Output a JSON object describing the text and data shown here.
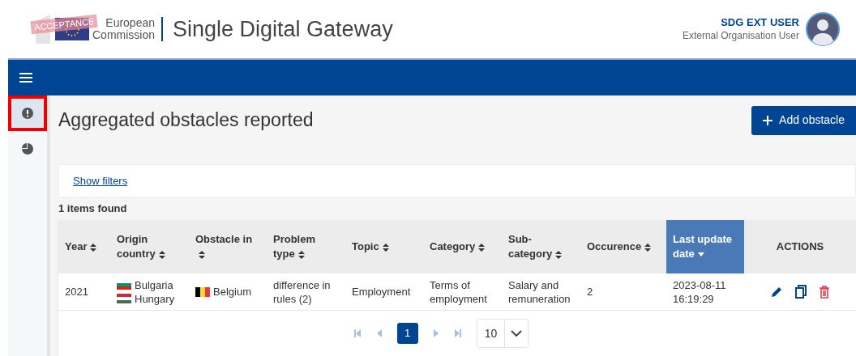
{
  "header": {
    "logo": {
      "line1": "European",
      "line2": "Commission",
      "stamp": "ACCEPTANCE"
    },
    "app_title": "Single Digital Gateway",
    "user": {
      "name": "SDG EXT USER",
      "role": "External Organisation User"
    }
  },
  "sidebar": {
    "items": [
      {
        "kind": "alert",
        "selected": true
      },
      {
        "kind": "chart",
        "selected": false
      }
    ]
  },
  "page": {
    "title": "Aggregated obstacles reported",
    "add_button": "Add obstacle",
    "filters_link": "Show filters",
    "count": "1 items found"
  },
  "table": {
    "columns": [
      {
        "label": "Year",
        "sortable": true,
        "sorted": false,
        "selected": false
      },
      {
        "label": "Origin country",
        "sortable": true,
        "sorted": false,
        "selected": false
      },
      {
        "label": "Obstacle in",
        "sortable": true,
        "sorted": false,
        "selected": false
      },
      {
        "label": "Problem type",
        "sortable": true,
        "sorted": false,
        "selected": false
      },
      {
        "label": "Topic",
        "sortable": true,
        "sorted": false,
        "selected": false
      },
      {
        "label": "Category",
        "sortable": true,
        "sorted": false,
        "selected": false
      },
      {
        "label": "Sub-category",
        "sortable": true,
        "sorted": false,
        "selected": false
      },
      {
        "label": "Occurence",
        "sortable": true,
        "sorted": false,
        "selected": false
      },
      {
        "label": "Last update date",
        "sortable": true,
        "sorted": true,
        "selected": true
      },
      {
        "label": "ACTIONS",
        "sortable": false,
        "selected": false
      }
    ],
    "rows": [
      {
        "year": "2021",
        "origin": [
          {
            "name": "Bulgaria",
            "vertical_stripes": false,
            "stripes": [
              {
                "color": "#ffffff"
              },
              {
                "color": "#00966e"
              },
              {
                "color": "#d62612"
              }
            ]
          },
          {
            "name": "Hungary",
            "vertical_stripes": false,
            "stripes": [
              {
                "color": "#ce2939"
              },
              {
                "color": "#ffffff"
              },
              {
                "color": "#477050"
              }
            ]
          }
        ],
        "obstacle_in": [
          {
            "name": "Belgium",
            "vertical_stripes": true,
            "stripes": [
              {
                "color": "#000000"
              },
              {
                "color": "#fdda24"
              },
              {
                "color": "#ef3340"
              }
            ]
          }
        ],
        "problem_type": "difference in rules (2)",
        "topic": "Employment",
        "category": "Terms of employment",
        "subcategory": "Salary and remuneration",
        "occurence": "2",
        "last_update": "2023-08-11 16:19:29",
        "actions": [
          {
            "kind": "edit"
          },
          {
            "kind": "copy"
          },
          {
            "kind": "delete"
          }
        ]
      }
    ]
  },
  "pagination": {
    "pages": [
      {
        "label": "1",
        "selected": true
      }
    ],
    "page_size": "10"
  }
}
